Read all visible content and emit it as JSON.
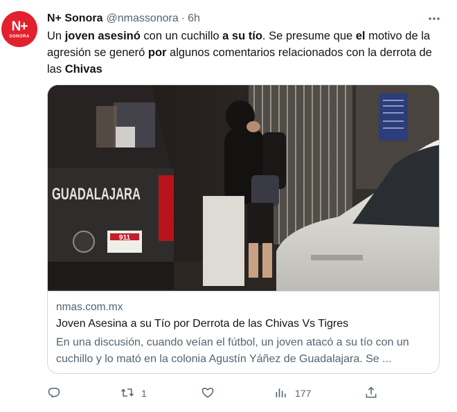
{
  "author": {
    "name": "N+ Sonora",
    "handle": "@nmassonora",
    "separator": "·",
    "time": "6h"
  },
  "avatar": {
    "logo": "N+",
    "subtitle": "SONORA",
    "color": "#e3202e"
  },
  "tweet": {
    "t1": "Un ",
    "b1": "joven asesinó",
    "t2": " con un cuchillo ",
    "b2": "a su tío",
    "t3": ". Se presume que ",
    "b3": "el",
    "t4": " motivo de la agresión se generó ",
    "b4": "por",
    "t5": " algunos comentarios relacionados con la derrota de las ",
    "b5": "Chivas"
  },
  "image": {
    "truck_text": "GUADALAJARA",
    "plate_text": "911"
  },
  "card": {
    "domain": "nmas.com.mx",
    "title": "Joven Asesina a su Tío por Derrota de las Chivas Vs Tigres",
    "description": "En una discusión, cuando veían el fútbol, un joven atacó a su tío con un cuchillo y lo mató en la colonia Agustín Yáñez de Guadalajara. Se ..."
  },
  "actions": {
    "reply_count": "",
    "retweet_count": "1",
    "like_count": "",
    "views_count": "177"
  },
  "icons": [
    "more-icon",
    "reply-icon",
    "retweet-icon",
    "like-icon",
    "views-icon",
    "share-icon"
  ]
}
